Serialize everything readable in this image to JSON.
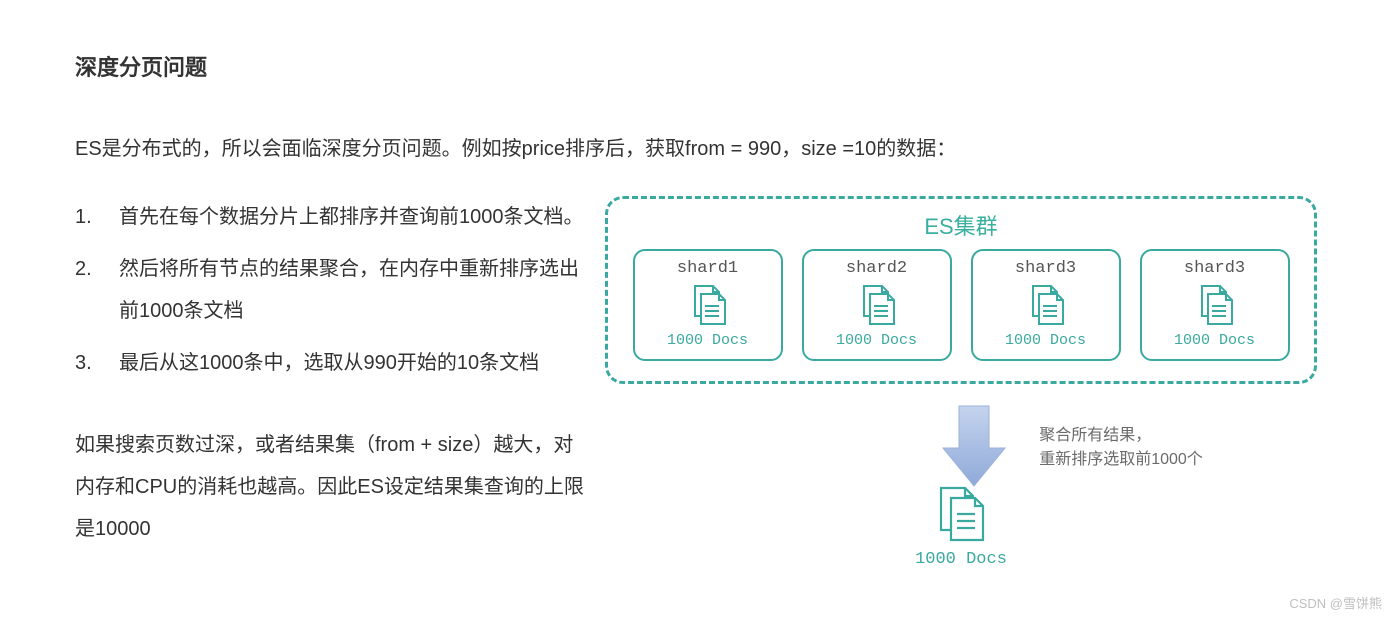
{
  "title": "深度分页问题",
  "intro": "ES是分布式的，所以会面临深度分页问题。例如按price排序后，获取from = 990，size =10的数据：",
  "steps": [
    "首先在每个数据分片上都排序并查询前1000条文档。",
    "然后将所有节点的结果聚合，在内存中重新排序选出前1000条文档",
    "最后从这1000条中，选取从990开始的10条文档"
  ],
  "summary": "如果搜索页数过深，或者结果集（from + size）越大，对内存和CPU的消耗也越高。因此ES设定结果集查询的上限是10000",
  "diagram": {
    "cluster_title": "ES集群",
    "shards": [
      {
        "name": "shard1",
        "docs": "1000 Docs"
      },
      {
        "name": "shard2",
        "docs": "1000 Docs"
      },
      {
        "name": "shard3",
        "docs": "1000 Docs"
      },
      {
        "name": "shard3",
        "docs": "1000 Docs"
      }
    ],
    "annotation_line1": "聚合所有结果，",
    "annotation_line2": "重新排序选取前1000个",
    "result_docs": "1000 Docs"
  },
  "watermark": "CSDN @雪饼熊"
}
